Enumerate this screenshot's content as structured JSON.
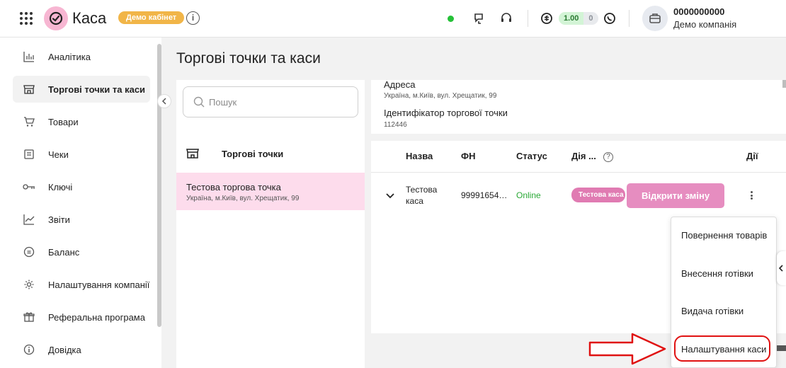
{
  "header": {
    "app_title": "Каса",
    "demo_badge": "Демо кабінет",
    "info_glyph": "i",
    "balance_value": "1.00",
    "balance_secondary": "0",
    "account_id": "0000000000",
    "account_name": "Демо компанія",
    "status_color": "#25c138"
  },
  "sidebar": {
    "items": [
      {
        "label": "Аналітика",
        "icon": "bar-chart-icon"
      },
      {
        "label": "Торгові точки та каси",
        "icon": "store-icon"
      },
      {
        "label": "Товари",
        "icon": "cart-icon"
      },
      {
        "label": "Чеки",
        "icon": "receipt-icon"
      },
      {
        "label": "Ключі",
        "icon": "key-icon"
      },
      {
        "label": "Звіти",
        "icon": "trend-icon"
      },
      {
        "label": "Баланс",
        "icon": "coin-icon"
      },
      {
        "label": "Налаштування компанії",
        "icon": "gear-icon"
      },
      {
        "label": "Реферальна програма",
        "icon": "gift-icon"
      },
      {
        "label": "Довідка",
        "icon": "info-icon"
      }
    ]
  },
  "main": {
    "page_title": "Торгові точки та каси",
    "search_placeholder": "Пошук",
    "points_heading": "Торгові точки",
    "point": {
      "name": "Тестова торгова точка",
      "address": "Україна, м.Київ, вул. Хрещатик, 99"
    },
    "details": {
      "address_label": "Адреса",
      "address_value": "Україна, м.Київ, вул. Хрещатик, 99",
      "id_label": "Ідентифікатор торгової точки",
      "id_value": "112446"
    },
    "table": {
      "headers": {
        "name": "Назва",
        "fn": "ФН",
        "status": "Статус",
        "action": "Дія ...",
        "actions": "Дії"
      },
      "help_glyph": "?",
      "row": {
        "name": "Тестова каса",
        "fn": "99991654…",
        "status": "Online",
        "tag": "Тестова каса",
        "open_shift": "Відкрити зміну"
      }
    },
    "menu": [
      "Повернення товарів",
      "Внесення готівки",
      "Видача готівки",
      "Налаштування каси"
    ]
  },
  "colors": {
    "accent_pink": "#e68dc0",
    "selected_bg": "#fddcec",
    "demo_badge": "#f1b548",
    "annotation_red": "#e01212"
  }
}
